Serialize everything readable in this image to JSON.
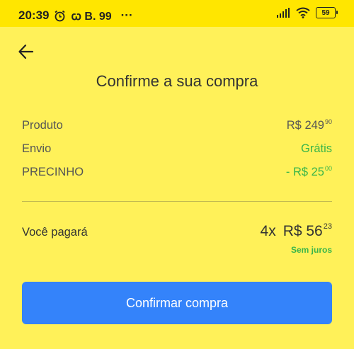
{
  "status": {
    "time": "20:39",
    "indicators": "ꞷ B. 99",
    "more": "···",
    "battery": "59"
  },
  "header": {
    "title": "Confirme a sua compra"
  },
  "summary": {
    "product": {
      "label": "Produto",
      "value": "R$ 249",
      "cents": "90"
    },
    "shipping": {
      "label": "Envio",
      "value": "Grátis"
    },
    "discount": {
      "label": "PRECINHO",
      "value": "- R$ 25",
      "cents": "00"
    }
  },
  "total": {
    "label": "Você pagará",
    "installments": "4x",
    "value": "R$ 56",
    "cents": "23",
    "note": "Sem juros"
  },
  "actions": {
    "confirm_label": "Confirmar compra"
  },
  "colors": {
    "background": "#fff159",
    "statusbar": "#ffe600",
    "primary": "#3483fa",
    "success": "#39b54a"
  }
}
